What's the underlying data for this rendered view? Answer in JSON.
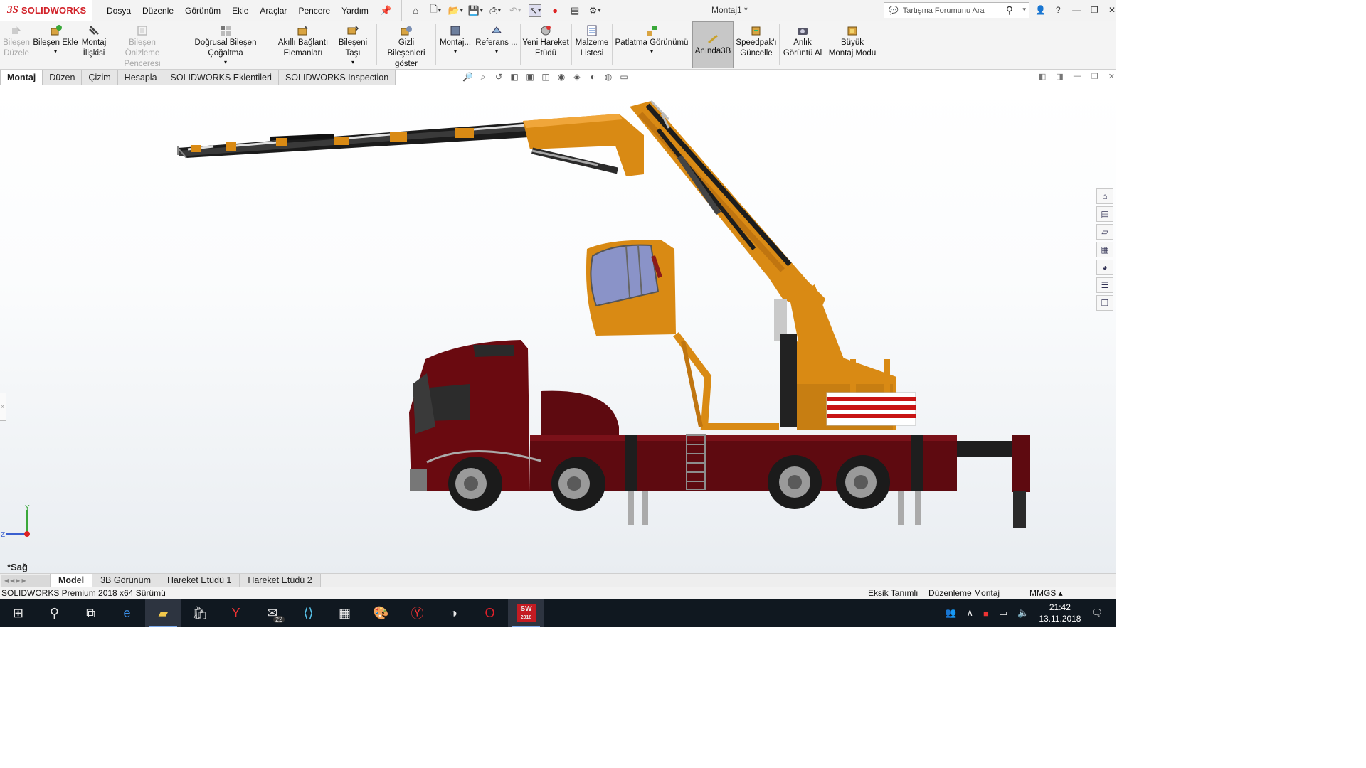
{
  "app": {
    "brand_ds": "3S",
    "brand_name": "SOLIDWORKS",
    "document_title": "Montaj1 *"
  },
  "menu": [
    "Dosya",
    "Düzenle",
    "Görünüm",
    "Ekle",
    "Araçlar",
    "Pencere",
    "Yardım"
  ],
  "search": {
    "placeholder": "Tartışma Forumunu Ara"
  },
  "commands": [
    {
      "label1": "Bileşen",
      "label2": "Düzele",
      "enabled": false,
      "icon": "edit-component-icon"
    },
    {
      "label1": "Bileşen Ekle",
      "label2": "",
      "enabled": true,
      "icon": "insert-component-icon"
    },
    {
      "label1": "Montaj",
      "label2": "İlişkisi",
      "enabled": true,
      "icon": "mate-icon"
    },
    {
      "label1": "Bileşen Önizleme",
      "label2": "Penceresi",
      "enabled": false,
      "icon": "preview-window-icon"
    },
    {
      "label1": "Doğrusal Bileşen Çoğaltma",
      "label2": "",
      "enabled": true,
      "icon": "linear-pattern-icon"
    },
    {
      "label1": "Akıllı Bağlantı",
      "label2": "Elemanları",
      "enabled": true,
      "icon": "smart-fasteners-icon"
    },
    {
      "label1": "Bileşeni Taşı",
      "label2": "",
      "enabled": true,
      "icon": "move-component-icon"
    },
    {
      "label1": "Gizli Bileşenleri",
      "label2": "göster",
      "enabled": true,
      "icon": "show-hidden-icon"
    },
    {
      "label1": "Montaj...",
      "label2": "",
      "enabled": true,
      "icon": "assembly-features-icon"
    },
    {
      "label1": "Referans ...",
      "label2": "",
      "enabled": true,
      "icon": "reference-geometry-icon"
    },
    {
      "label1": "Yeni Hareket",
      "label2": "Etüdü",
      "enabled": true,
      "icon": "motion-study-icon"
    },
    {
      "label1": "Malzeme",
      "label2": "Listesi",
      "enabled": true,
      "icon": "bom-icon"
    },
    {
      "label1": "Patlatma Görünümü",
      "label2": "",
      "enabled": true,
      "icon": "exploded-view-icon"
    },
    {
      "label1": "Anında3B",
      "label2": "",
      "enabled": true,
      "icon": "instant3d-icon"
    },
    {
      "label1": "Speedpak'ı",
      "label2": "Güncelle",
      "enabled": true,
      "icon": "speedpak-icon"
    },
    {
      "label1": "Anlık",
      "label2": "Görüntü Al",
      "enabled": true,
      "icon": "snapshot-icon"
    },
    {
      "label1": "Büyük",
      "label2": "Montaj Modu",
      "enabled": true,
      "icon": "large-assembly-icon"
    }
  ],
  "tabs": [
    "Montaj",
    "Düzen",
    "Çizim",
    "Hesapla",
    "SOLIDWORKS Eklentileri",
    "SOLIDWORKS Inspection"
  ],
  "viewport": {
    "view_name": "*Sağ",
    "triad": {
      "y": "Y",
      "z": "Z"
    }
  },
  "bottom_tabs": [
    "Model",
    "3B Görünüm",
    "Hareket Etüdü 1",
    "Hareket Etüdü 2"
  ],
  "status": {
    "version": "SOLIDWORKS Premium 2018 x64 Sürümü",
    "definition": "Eksik Tanımlı",
    "mode": "Düzenleme Montaj",
    "units": "MMGS"
  },
  "taskbar": {
    "mail_badge": "22",
    "time": "21:42",
    "date": "13.11.2018",
    "sw_icon_text": "SW",
    "sw_year": "2018"
  },
  "colors": {
    "brand": "#d2232a",
    "crane": "#d98a14",
    "truck": "#6a0a10"
  }
}
